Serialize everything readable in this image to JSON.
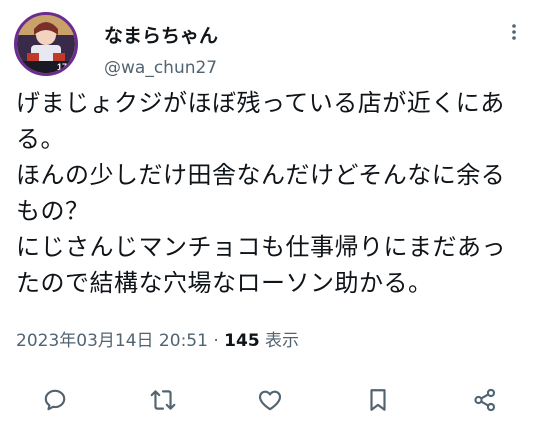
{
  "tweet": {
    "display_name": "なまらちゃん",
    "handle": "@wa_chun27",
    "lines": [
      "げまじょクジがほぼ残っている店が近くにあ",
      "る。",
      "ほんの少しだけ田舎なんだけどそんなに余る",
      "もの？",
      "にじさんじマンチョコも仕事帰りにまだあっ",
      "たので結構な穴場なローソン助かる。"
    ],
    "timestamp": "2023年03月14日 20:51",
    "separator": " · ",
    "views_count": "145",
    "views_label": " 表示"
  },
  "icons": {
    "more": "more-dots-icon",
    "reply": "reply-icon",
    "retweet": "retweet-icon",
    "like": "heart-icon",
    "bookmark": "bookmark-icon",
    "share": "share-icon"
  },
  "colors": {
    "text_primary": "#0f1419",
    "text_secondary": "#536471",
    "avatar_border": "#6b2b8f"
  }
}
